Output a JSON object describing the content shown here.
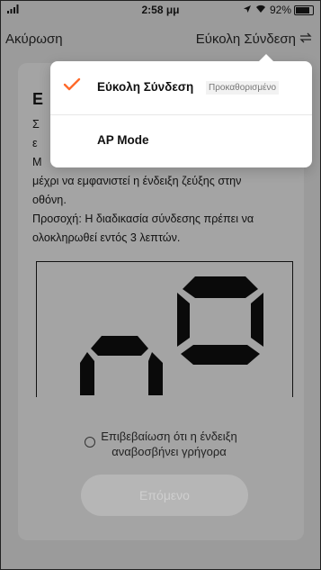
{
  "status_bar": {
    "time": "2:58 μμ",
    "battery": "92%"
  },
  "nav": {
    "cancel_label": "Ακύρωση",
    "mode_label": "Εύκολη Σύνδεση"
  },
  "card": {
    "title": "Ε",
    "line1": "Σ",
    "line2": "ε",
    "line3": "Μ",
    "line4": "μέχρι να εμφανιστεί η ένδειξη ζεύξης στην",
    "line5": "οθόνη.",
    "line6": "Προσοχή: Η διαδικασία σύνδεσης πρέπει να",
    "line7": "ολοκληρωθεί εντός 3 λεπτών.",
    "confirm_line1": "Επιβεβαίωση ότι η ένδειξη",
    "confirm_line2": "αναβοσβήνει γρήγορα",
    "next_label": "Επόμενο"
  },
  "menu": {
    "items": [
      {
        "label": "Εύκολη Σύνδεση",
        "badge": "Προκαθορισμένο",
        "selected": true
      },
      {
        "label": "AP Mode",
        "selected": false
      }
    ]
  },
  "colors": {
    "accent": "#ff6a2b",
    "overlay_bg": "#9b9b9b"
  },
  "icons": {
    "nav_right": "swap-icon",
    "check": "check-icon",
    "radio": "radio-icon"
  }
}
